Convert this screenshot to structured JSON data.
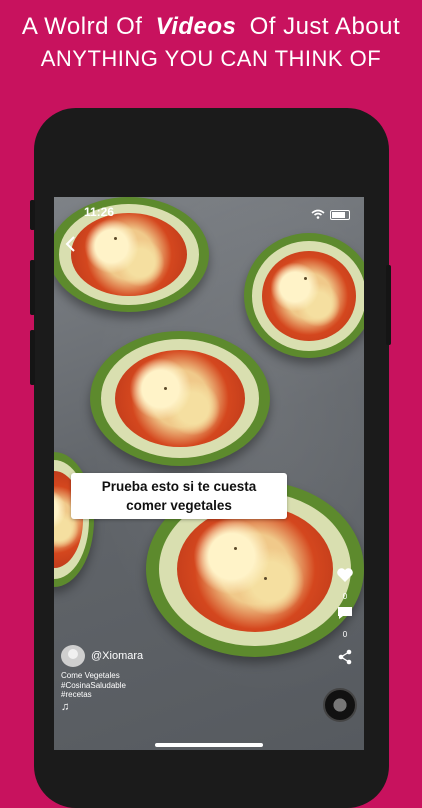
{
  "headline": {
    "line1_before": "A Wolrd Of",
    "line1_emphasis": "Videos",
    "line1_after": "Of Just About",
    "line2": "ANYTHING YOU CAN THINK OF"
  },
  "colors": {
    "background": "#c8125e",
    "phone": "#1b1b1b",
    "caption_bg": "#ffffff"
  },
  "status_bar": {
    "time": "11:26",
    "icons": [
      "wifi-icon",
      "battery-icon"
    ]
  },
  "video": {
    "caption_line1": "Prueba esto si te cuesta",
    "caption_line2": "comer vegetales",
    "username": "@Xiomara",
    "description": [
      "Come Vegetales",
      "#CosinaSaludable",
      "#recetas"
    ],
    "like_count": "0",
    "comment_count": "0"
  }
}
